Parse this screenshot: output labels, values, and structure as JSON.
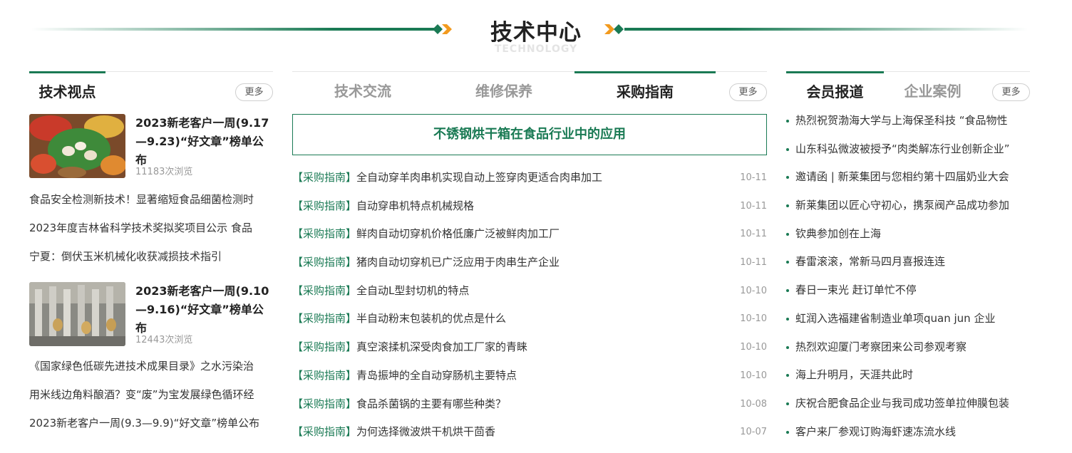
{
  "section": {
    "title": "技术中心",
    "subtitle": "TECHNOLOGY",
    "accent_color": "#1a7a54",
    "deco_color": "#f29a1e"
  },
  "col1": {
    "tab_label": "技术视点",
    "more_label": "更多",
    "features": [
      {
        "title": "2023新老客户一周(9.17—9.23)“好文章”榜单公布",
        "views": "11183次浏览",
        "image": "vegetables-photo"
      },
      {
        "title": "2023新老客户一周(9.10—9.16)“好文章”榜单公布",
        "views": "12443次浏览",
        "image": "factory-machine-photo"
      }
    ],
    "list1": [
      "食品安全检测新技术！显著缩短食品细菌检测时",
      "2023年度吉林省科学技术奖拟奖项目公示 食品",
      "宁夏：倒伏玉米机械化收获减损技术指引"
    ],
    "list2": [
      "《国家绿色低碳先进技术成果目录》之水污染治",
      "用米线边角料酿酒？变“废”为宝发展绿色循环经",
      "2023新老客户一周(9.3—9.9)“好文章”榜单公布"
    ]
  },
  "col2": {
    "tabs": [
      "技术交流",
      "维修保养",
      "采购指南"
    ],
    "active_tab": 2,
    "more_label": "更多",
    "highlight": "不锈钢烘干箱在食品行业中的应用",
    "items": [
      {
        "tag": "【采购指南】",
        "title": "全自动穿羊肉串机实现自动上签穿肉更适合肉串加工",
        "date": "10-11"
      },
      {
        "tag": "【采购指南】",
        "title": "自动穿串机特点机械规格",
        "date": "10-11"
      },
      {
        "tag": "【采购指南】",
        "title": "鲜肉自动切穿机价格低廉广泛被鲜肉加工厂",
        "date": "10-11"
      },
      {
        "tag": "【采购指南】",
        "title": "猪肉自动切穿机已广泛应用于肉串生产企业",
        "date": "10-11"
      },
      {
        "tag": "【采购指南】",
        "title": "全自动L型封切机的特点",
        "date": "10-10"
      },
      {
        "tag": "【采购指南】",
        "title": "半自动粉末包装机的优点是什么",
        "date": "10-10"
      },
      {
        "tag": "【采购指南】",
        "title": "真空滚揉机深受肉食加工厂家的青睐",
        "date": "10-10"
      },
      {
        "tag": "【采购指南】",
        "title": "青岛振坤的全自动穿肠机主要特点",
        "date": "10-10"
      },
      {
        "tag": "【采购指南】",
        "title": "食品杀菌锅的主要有哪些种类？",
        "date": "10-08"
      },
      {
        "tag": "【采购指南】",
        "title": "为何选择微波烘干机烘干茴香",
        "date": "10-07"
      }
    ]
  },
  "col3": {
    "tabs": [
      "会员报道",
      "企业案例"
    ],
    "active_tab": 0,
    "more_label": "更多",
    "items": [
      "热烈祝贺渤海大学与上海保圣科技 “食品物性",
      "山东科弘微波被授予“肉类解冻行业创新企业”",
      "邀请函 | 新莱集团与您相约第十四届奶业大会",
      "新莱集团以匠心守初心，携泵阀产品成功参加",
      "钦典参加创在上海",
      "春雷滚滚，常新马四月喜报连连",
      "春日一束光 赶订单忙不停",
      "虹润入选福建省制造业单项quan jun 企业",
      "热烈欢迎厦门考察团来公司参观考察",
      "海上升明月，天涯共此时",
      "庆祝合肥食品企业与我司成功签单拉伸膜包装",
      "客户来厂参观订购海虾速冻流水线"
    ]
  }
}
